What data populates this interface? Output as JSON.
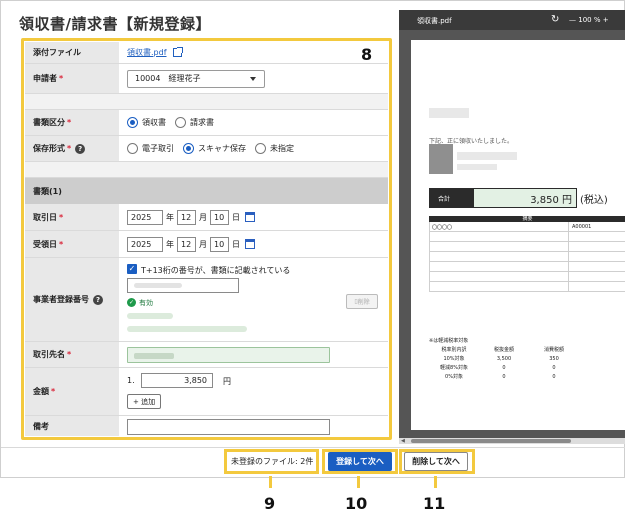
{
  "page_title": "領収書/請求書【新規登録】",
  "form": {
    "attachment": {
      "label": "添付ファイル",
      "file_name": "領収書.pdf"
    },
    "applicant": {
      "label": "申請者",
      "required_mark": "*",
      "value": "10004　経理花子"
    },
    "doc_type": {
      "label": "書類区分",
      "required_mark": "*",
      "options": [
        "領収書",
        "請求書"
      ],
      "selected": "領収書"
    },
    "storage": {
      "label": "保存形式",
      "required_mark": "*",
      "help_icon": "?",
      "options": [
        "電子取引",
        "スキャナ保存",
        "未指定"
      ],
      "selected": "スキャナ保存"
    },
    "section_title": "書類(1)",
    "transaction_date": {
      "label": "取引日",
      "required_mark": "*",
      "year": "2025",
      "year_unit": "年",
      "month": "12",
      "month_unit": "月",
      "day": "10",
      "day_unit": "日"
    },
    "received_date": {
      "label": "受領日",
      "required_mark": "*",
      "year": "2025",
      "year_unit": "年",
      "month": "12",
      "month_unit": "月",
      "day": "10",
      "day_unit": "日"
    },
    "registration": {
      "label": "事業者登録番号",
      "help_icon": "?",
      "checkbox_label": "T+13桁の番号が、書類に記載されている",
      "status": "有効",
      "side_button": "削除"
    },
    "vendor": {
      "label": "取引先名",
      "required_mark": "*"
    },
    "amount": {
      "label": "金額",
      "required_mark": "*",
      "index": "1.",
      "value": "3,850",
      "unit": "円",
      "add_button": "+ 追加"
    },
    "memo": {
      "label": "備考"
    }
  },
  "callouts": {
    "form": "8",
    "unregistered": "9",
    "register_next": "10",
    "delete_next": "11"
  },
  "preview": {
    "file_name": "領収書.pdf",
    "zoom": "100 %",
    "doc_text": "下記、正に領収いたしました。",
    "total_label": "合計",
    "total_value": "3,850 円",
    "total_tax": "(税込)",
    "table_header": "摘要",
    "row1_col1": "〇〇〇〇",
    "row1_col2": "A00001",
    "tax_heading": "※は軽減税率対象",
    "tax_headers": [
      "税率別内訳",
      "税抜金額",
      "消費税額"
    ],
    "tax_rows": [
      [
        "10%対象",
        "3,500",
        "350"
      ],
      [
        "軽減8%対象",
        "0",
        "0"
      ],
      [
        "0%対象",
        "0",
        "0"
      ]
    ]
  },
  "footer": {
    "unregistered_files": "未登録のファイル: 2件",
    "register_next": "登録して次へ",
    "delete_next": "削除して次へ"
  },
  "colors": {
    "accent": "#1a5ec2",
    "highlight": "#f3c93e",
    "required": "#d9263a"
  }
}
